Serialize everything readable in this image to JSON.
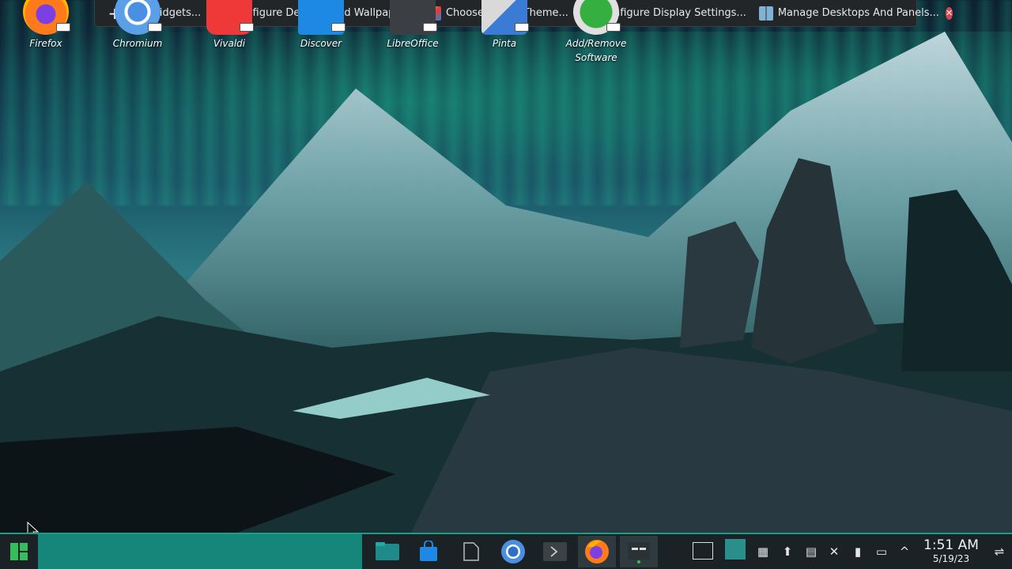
{
  "toolbox": {
    "items": [
      {
        "label": "Add Widgets...",
        "icon": "plus-icon"
      },
      {
        "label": "Configure Desktop and Wallpaper...",
        "icon": "desktop-wallpaper-icon"
      },
      {
        "label": "Choose Global Theme...",
        "icon": "theme-icon"
      },
      {
        "label": "Configure Display Settings...",
        "icon": "display-icon"
      },
      {
        "label": "Manage Desktops And Panels...",
        "icon": "desktops-panels-icon"
      }
    ],
    "close_icon": "close-icon"
  },
  "desktop_icons": [
    {
      "label": "Firefox",
      "color": "#ff7a1a"
    },
    {
      "label": "Chromium",
      "color": "#4a90e2"
    },
    {
      "label": "Vivaldi",
      "color": "#ef3939"
    },
    {
      "label": "Discover",
      "color": "#1e88e5"
    },
    {
      "label": "LibreOffice",
      "color": "#3b3f44"
    },
    {
      "label": "Pinta",
      "color": "#d9d9d9"
    },
    {
      "label": "Add/Remove\nSoftware",
      "color": "#35b040"
    }
  ],
  "taskbar": {
    "tasks": [
      {
        "name": "file-manager",
        "icon": "folder-icon"
      },
      {
        "name": "discover",
        "icon": "shopping-bag-icon"
      },
      {
        "name": "libreoffice",
        "icon": "document-icon"
      },
      {
        "name": "chromium",
        "icon": "chromium-icon"
      },
      {
        "name": "terminal",
        "icon": "terminal-icon"
      },
      {
        "name": "firefox",
        "icon": "firefox-icon"
      },
      {
        "name": "kde-settings",
        "icon": "settings-panel-icon"
      }
    ],
    "clock": {
      "time": "1:51 AM",
      "date": "5/19/23"
    }
  },
  "colors": {
    "accent": "#16a085",
    "panel": "#1b2225",
    "toolbox": "#232629"
  }
}
